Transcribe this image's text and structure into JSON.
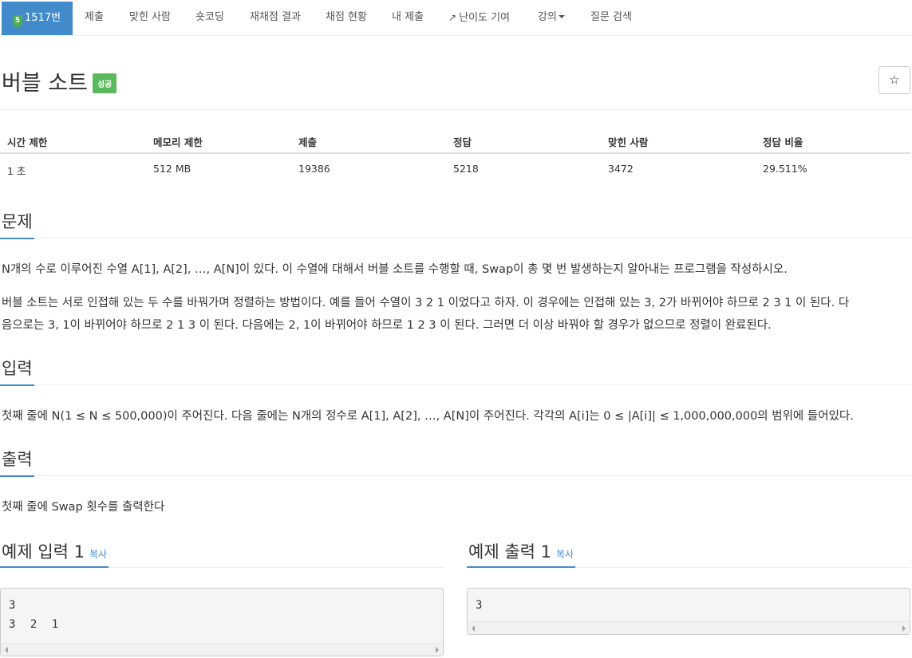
{
  "nav": {
    "problem_badge": "5",
    "problem_number": "1517번",
    "items": [
      "제출",
      "맞힌 사람",
      "숏코딩",
      "재채점 결과",
      "채점 현황",
      "내 제출",
      "난이도 기여",
      "강의",
      "질문 검색"
    ]
  },
  "header": {
    "title": "버블 소트",
    "status_badge": "성공",
    "star": "☆"
  },
  "stats": {
    "headers": [
      "시간 제한",
      "메모리 제한",
      "제출",
      "정답",
      "맞힌 사람",
      "정답 비율"
    ],
    "values": [
      "1 초",
      "512 MB",
      "19386",
      "5218",
      "3472",
      "29.511%"
    ]
  },
  "problem": {
    "title": "문제",
    "p1": "N개의 수로 이루어진 수열 A[1], A[2], …, A[N]이 있다. 이 수열에 대해서 버블 소트를 수행할 때, Swap이 총 몇 번 발생하는지 알아내는 프로그램을 작성하시오.",
    "p2_line1": "버블 소트는 서로 인접해 있는 두 수를 바꿔가며 정렬하는 방법이다. 예를 들어 수열이 3 2 1 이었다고 하자. 이 경우에는 인접해 있는 3, 2가 바뀌어야 하므로 2 3 1 이 된다. 다",
    "p2_line2": "음으로는 3, 1이 바뀌어야 하므로 2 1 3 이 된다. 다음에는 2, 1이 바뀌어야 하므로 1 2 3 이 된다. 그러면 더 이상 바꿔야 할 경우가 없으므로 정렬이 완료된다."
  },
  "input": {
    "title": "입력",
    "text": "첫째 줄에 N(1 ≤ N ≤ 500,000)이 주어진다. 다음 줄에는 N개의 정수로 A[1], A[2], …, A[N]이 주어진다. 각각의 A[i]는 0 ≤ |A[i]| ≤ 1,000,000,000의 범위에 들어있다."
  },
  "output": {
    "title": "출력",
    "text": "첫째 줄에 Swap 횟수를 출력한다"
  },
  "sample_input": {
    "title": "예제 입력 1",
    "copy": "복사",
    "lines": [
      "3",
      "3 2 1"
    ]
  },
  "sample_output": {
    "title": "예제 출력 1",
    "copy": "복사",
    "lines": [
      "3"
    ]
  }
}
